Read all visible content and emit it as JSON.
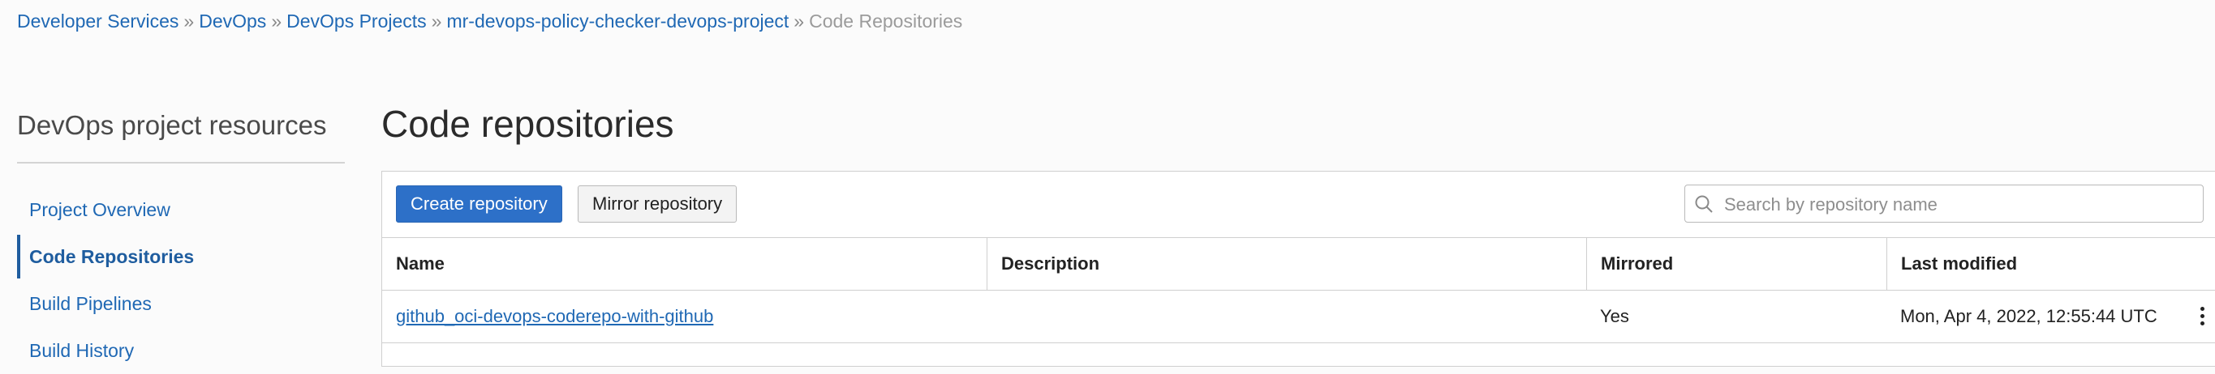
{
  "breadcrumb": {
    "items": [
      "Developer Services",
      "DevOps",
      "DevOps Projects",
      "mr-devops-policy-checker-devops-project"
    ],
    "separator": "»",
    "current": "Code Repositories"
  },
  "sidebar": {
    "title": "DevOps project resources",
    "items": [
      {
        "label": "Project Overview"
      },
      {
        "label": "Code Repositories"
      },
      {
        "label": "Build Pipelines"
      },
      {
        "label": "Build History"
      }
    ]
  },
  "main": {
    "title": "Code repositories",
    "create_button": "Create repository",
    "mirror_button": "Mirror repository",
    "search": {
      "placeholder": "Search by repository name",
      "icon": "search-icon"
    },
    "table": {
      "columns": [
        "Name",
        "Description",
        "Mirrored",
        "Last modified"
      ],
      "rows": [
        {
          "name": "github_oci-devops-coderepo-with-github",
          "description": "",
          "mirrored": "Yes",
          "last_modified": "Mon, Apr 4, 2022, 12:55:44 UTC"
        }
      ]
    }
  },
  "colors": {
    "link": "#1f68b4",
    "primary": "#2d70c8"
  }
}
